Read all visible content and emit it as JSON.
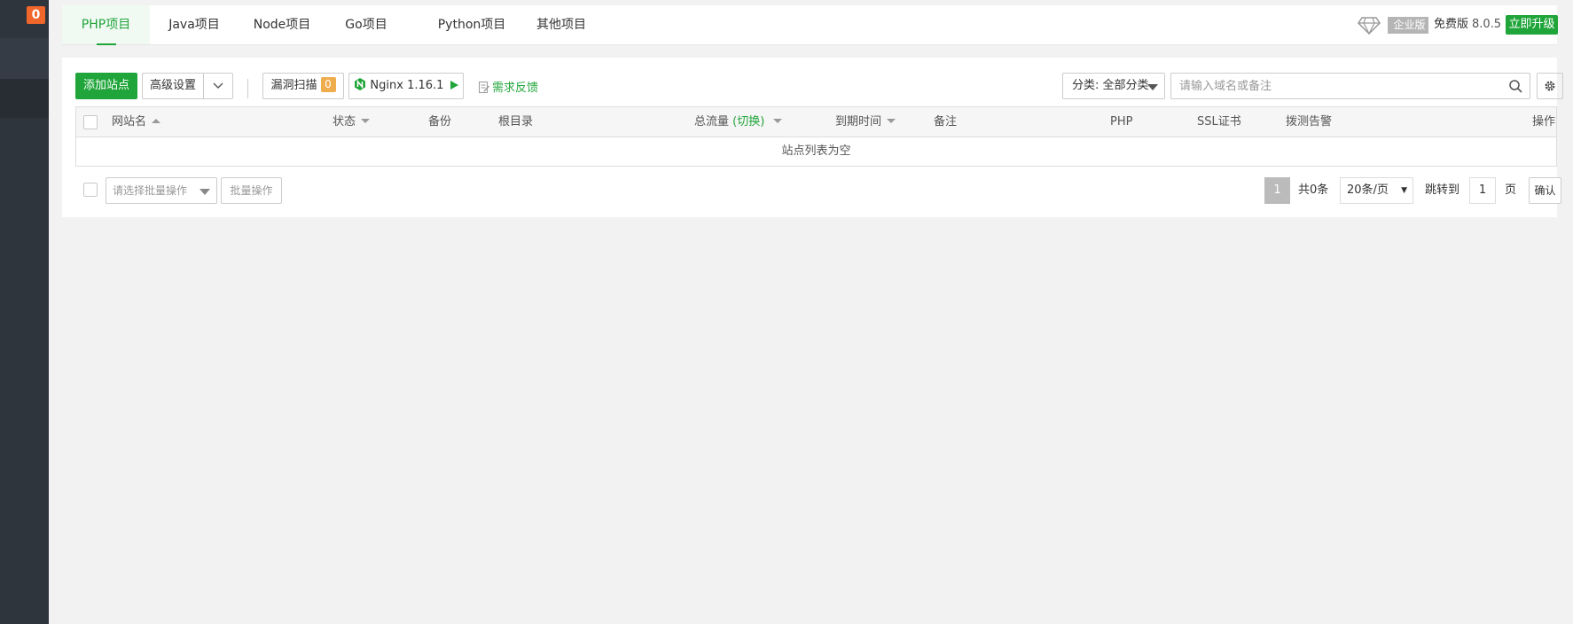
{
  "sidebar": {
    "badge_count": "0"
  },
  "tabs": [
    {
      "label": "PHP项目"
    },
    {
      "label": "Java项目"
    },
    {
      "label": "Node项目"
    },
    {
      "label": "Go项目"
    },
    {
      "label": "Python项目"
    },
    {
      "label": "其他项目"
    }
  ],
  "header": {
    "edition_badge": "企业版",
    "free_label": "免费版",
    "version": "8.0.5",
    "upgrade_label": "立即升级"
  },
  "toolbar": {
    "add_site": "添加站点",
    "advanced": "高级设置",
    "vuln_scan": "漏洞扫描",
    "vuln_count": "0",
    "nginx": "Nginx 1.16.1",
    "feedback": "需求反馈",
    "category": "分类: 全部分类",
    "search_placeholder": "请输入域名或备注"
  },
  "table": {
    "columns": {
      "site_name": "网站名",
      "status": "状态",
      "backup": "备份",
      "root": "根目录",
      "traffic": "总流量",
      "switch": "(切换)",
      "expire": "到期时间",
      "remark": "备注",
      "php": "PHP",
      "ssl": "SSL证书",
      "monitor": "拨测告警",
      "actions": "操作"
    },
    "empty_text": "站点列表为空"
  },
  "footer": {
    "batch_placeholder": "请选择批量操作",
    "batch_button": "批量操作",
    "current_page": "1",
    "total": "共0条",
    "per_page": "20条/页",
    "jump_label": "跳转到",
    "jump_value": "1",
    "page_unit": "页",
    "confirm": "确认"
  }
}
